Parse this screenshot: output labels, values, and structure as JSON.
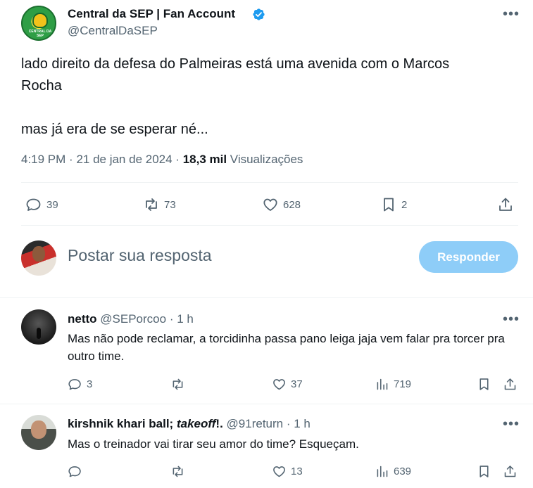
{
  "tweet": {
    "display_name": "Central da SEP | Fan Account",
    "handle": "@CentralDaSEP",
    "avatar_text": "CENTRAL DA SEP",
    "text": "lado direito da defesa do Palmeiras está uma avenida com o Marcos\nRocha\n\nmas já era de se esperar né...",
    "time": "4:19 PM",
    "date": "21 de jan de 2024",
    "views_count": "18,3 mil",
    "views_label": "Visualizações",
    "stats": {
      "replies": "39",
      "retweets": "73",
      "likes": "628",
      "bookmarks": "2"
    }
  },
  "composer": {
    "placeholder": "Postar sua resposta",
    "button_label": "Responder"
  },
  "replies": [
    {
      "name": "netto",
      "name_italic": "",
      "name_suffix": "",
      "handle": "@SEPorcoo",
      "time": "1 h",
      "text": "Mas não pode reclamar, a torcidinha passa pano leiga jaja vem falar pra torcer pra outro time.",
      "replies": "3",
      "retweets": "",
      "likes": "37",
      "views": "719"
    },
    {
      "name": "kirshnik khari ball;",
      "name_italic": "takeoff",
      "name_suffix": "!.",
      "handle": "@91return",
      "time": "1 h",
      "text": "Mas o treinador vai tirar seu amor do time? Esqueçam.",
      "replies": "",
      "retweets": "",
      "likes": "13",
      "views": "639"
    }
  ],
  "colors": {
    "accent": "#1d9bf0",
    "reply_button": "#8ecdf8",
    "muted_text": "#536471",
    "divider": "#eff3f4"
  },
  "icons": [
    "verified-badge-icon",
    "more-icon",
    "reply-icon",
    "retweet-icon",
    "like-icon",
    "bookmark-icon",
    "share-icon",
    "views-icon"
  ]
}
